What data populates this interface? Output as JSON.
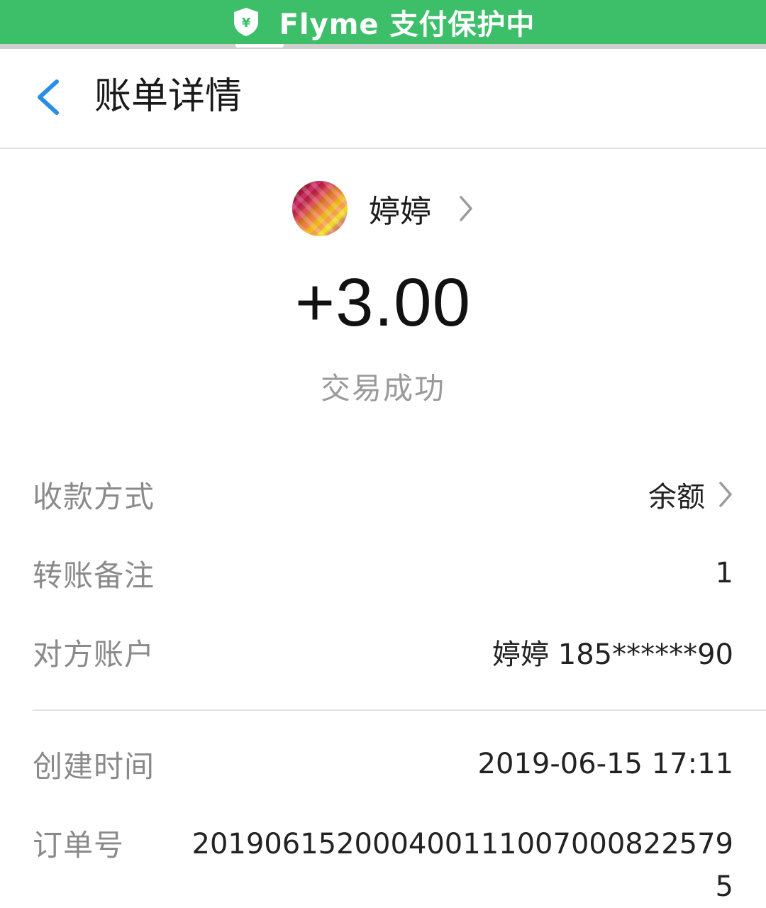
{
  "banner": {
    "text": "Flyme 支付保护中",
    "icon": "shield-yen-icon",
    "color": "#3dbf6a"
  },
  "header": {
    "title": "账单详情",
    "back_icon": "chevron-left-icon",
    "accent": "#2a8ee6"
  },
  "payer": {
    "name": "婷婷",
    "avatar": "avatar-photo",
    "chevron": "chevron-right-icon"
  },
  "transaction": {
    "amount": "+3.00",
    "status": "交易成功"
  },
  "details": [
    {
      "label": "收款方式",
      "value": "余额",
      "has_chevron": true
    },
    {
      "label": "转账备注",
      "value": "1",
      "has_chevron": false
    },
    {
      "label": "对方账户",
      "value": "婷婷 185******90",
      "has_chevron": false
    }
  ],
  "meta": {
    "created_label": "创建时间",
    "created_value": "2019-06-15 17:11",
    "order_label": "订单号",
    "order_value": "2019061520004001110070008225795"
  }
}
